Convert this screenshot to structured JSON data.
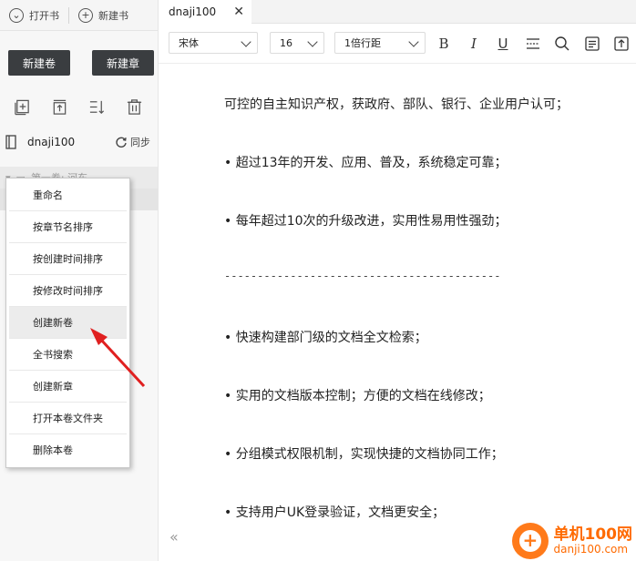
{
  "sidebar": {
    "open_book": "打开书",
    "new_book": "新建书",
    "new_volume_btn": "新建卷",
    "new_chapter_btn": "新建章",
    "book_name": "dnaji100",
    "sync": "同步",
    "volume_label": "第一卷: 河东"
  },
  "context_menu": {
    "items": [
      "重命名",
      "按章节名排序",
      "按创建时间排序",
      "按修改时间排序",
      "创建新卷",
      "全书搜索",
      "创建新章",
      "打开本卷文件夹",
      "删除本卷"
    ],
    "active_index": 4
  },
  "tab": {
    "title": "dnaji100"
  },
  "toolbar": {
    "font_family": "宋体",
    "font_size": "16",
    "line_spacing": "1倍行距",
    "icons": [
      "bold-icon",
      "italic-icon",
      "underline-icon",
      "strikethrough-icon",
      "search-icon",
      "notes-icon",
      "export-icon"
    ]
  },
  "document": {
    "lines": [
      "可控的自主知识产权，获政府、部队、银行、企业用户认可；",
      "• 超过13年的开发、应用、普及，系统稳定可靠；",
      "• 每年超过10次的升级改进，实用性易用性强劲；",
      "------------------------------------------",
      "• 快速构建部门级的文档全文检索；",
      "• 实用的文档版本控制；方便的文档在线修改；",
      "• 分组模式权限机制，实现快捷的文档协同工作；",
      "• 支持用户UK登录验证，文档更安全；"
    ]
  },
  "watermark": {
    "title": "单机100网",
    "url": "danji100.com"
  },
  "colors": {
    "dark_button": "#3a3d40",
    "accent_arrow": "#e02020",
    "watermark": "#ff6a00"
  }
}
